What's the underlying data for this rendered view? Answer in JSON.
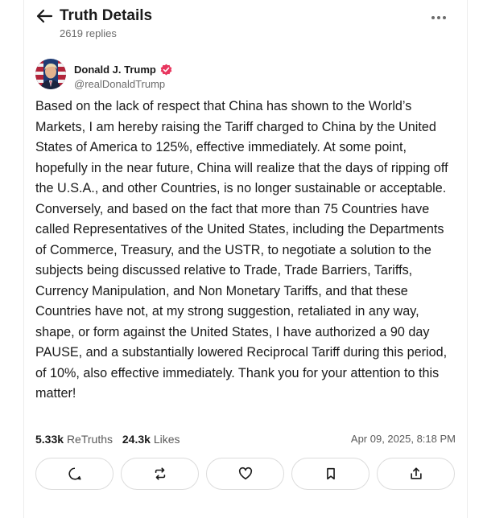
{
  "header": {
    "title": "Truth Details",
    "replies": "2619 replies"
  },
  "post": {
    "author_name": "Donald J. Trump",
    "author_handle": "@realDonaldTrump",
    "text": "Based on the lack of respect that China has shown to the World’s Markets, I am hereby raising the Tariff charged to China by the United States of America to 125%, effective immediately. At some point, hopefully in the near future, China will realize that the days of ripping off the U.S.A., and other Countries, is no longer sustainable or acceptable. Conversely, and based on the fact that more than 75 Countries have called Representatives of the United States, including the Departments of Commerce, Treasury, and the USTR, to negotiate a solution to the subjects being discussed relative to Trade, Trade Barriers, Tariffs, Currency Manipulation, and Non Monetary Tariffs, and that these Countries have not, at my strong suggestion, retaliated in any way, shape, or form against the United States, I have authorized a 90 day PAUSE, and a substantially lowered Reciprocal Tariff during this period, of 10%, also effective immediately. Thank you for your attention to this matter!",
    "retruths_count": "5.33k",
    "retruths_label": "ReTruths",
    "likes_count": "24.3k",
    "likes_label": "Likes",
    "timestamp": "Apr 09, 2025, 8:18 PM"
  },
  "icons": {
    "back": "arrow-left-icon",
    "more": "more-horizontal-icon",
    "verified": "verified-badge-icon",
    "reply": "reply-icon",
    "retruth": "retruth-icon",
    "like": "heart-icon",
    "bookmark": "bookmark-icon",
    "share": "share-icon"
  },
  "colors": {
    "verified_badge": "#e8375f",
    "text_primary": "#1a1a1a",
    "text_secondary": "#6b6b6b",
    "border": "#dcdcdc"
  }
}
